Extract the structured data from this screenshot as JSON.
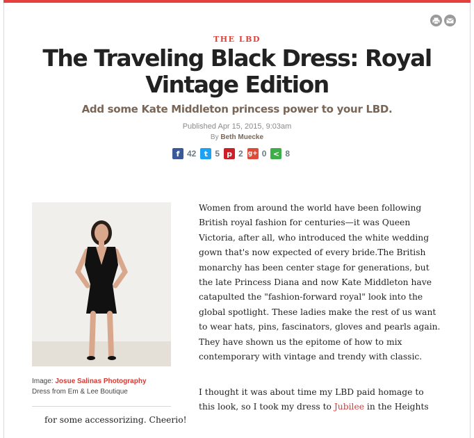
{
  "colors": {
    "accent": "#e5403d",
    "byline": "#7a6656",
    "facebook": "#3b5998",
    "twitter": "#1da1f2",
    "pinterest": "#cb2027",
    "googleplus": "#dd4b39",
    "share": "#3eae49"
  },
  "tools": {
    "print_icon": "print-icon",
    "email_icon": "email-icon"
  },
  "article": {
    "section": "THE LBD",
    "title": "The Traveling Black Dress: Royal Vintage Edition",
    "subtitle": "Add some Kate Middleton princess power to your LBD.",
    "published": "Published Apr 15, 2015, 9:03am",
    "by_prefix": "By",
    "author": "Beth Muecke"
  },
  "shares": [
    {
      "network": "facebook",
      "icon": "f",
      "count": "42"
    },
    {
      "network": "twitter",
      "icon": "t",
      "count": "5"
    },
    {
      "network": "pinterest",
      "icon": "p",
      "count": "2"
    },
    {
      "network": "googleplus",
      "icon": "g+",
      "count": "0"
    },
    {
      "network": "share",
      "icon": "<",
      "count": "8"
    }
  ],
  "image": {
    "caption_prefix": "Image:",
    "credit": "Josue Salinas Photography",
    "note": "Dress from Em & Lee Boutique"
  },
  "body": {
    "p1": "Women from around the world have been following British royal fashion for centuries—it was Queen Victoria, after all, who introduced the white wedding gown that's now expected of every bride.The British monarchy has been center stage for generations, but the late Princess Diana and now Kate Middleton have catapulted the \"fashion-forward royal\" look into the global spotlight. These ladies make the rest of us want to wear hats, pins, fascinators, gloves and pearls again. They have shown us the epitome of how to mix contemporary with vintage and trendy with classic.",
    "p2_before": "I thought it was about time my LBD paid homage to this look, so I took my dress to ",
    "p2_link": "Jubilee",
    "p2_after": " in the Heights",
    "p3": "for some accessorizing. Cheerio!"
  }
}
